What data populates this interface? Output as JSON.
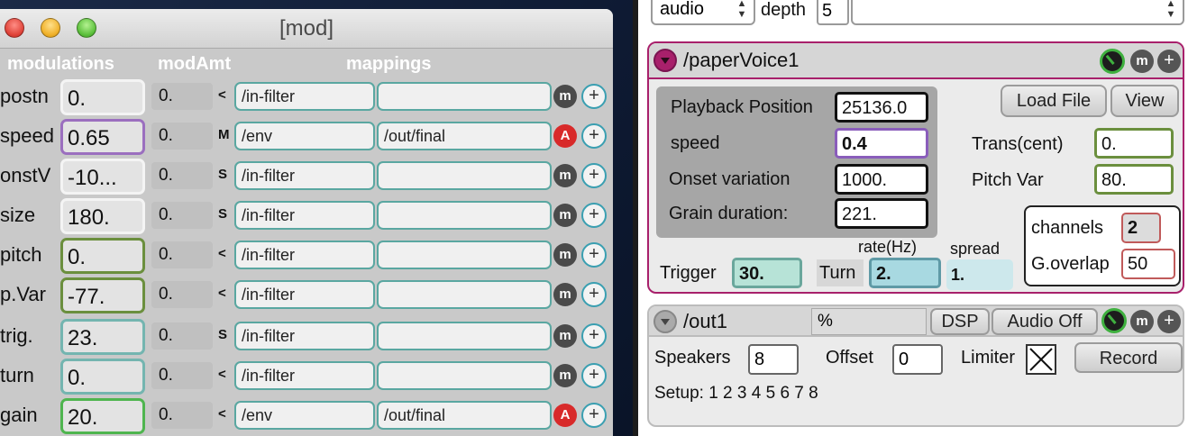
{
  "mod_window": {
    "title": "[mod]",
    "headers": {
      "modulations": "modulations",
      "modAmt": "modAmt",
      "mappings": "mappings"
    },
    "rows": [
      {
        "name": "postn",
        "value": "0.",
        "amt": "0.",
        "sym": "<",
        "src": "/in-filter",
        "dst": "",
        "m": "m",
        "m_active": false,
        "plus": "+",
        "border": "#f4f4f4"
      },
      {
        "name": "speed",
        "value": "0.65",
        "amt": "0.",
        "sym": "M",
        "src": "/env",
        "dst": "/out/final",
        "m": "A",
        "m_active": true,
        "plus": "+",
        "border": "#9b6fbf"
      },
      {
        "name": "onstV",
        "value": "-10...",
        "amt": "0.",
        "sym": "S",
        "src": "/in-filter",
        "dst": "",
        "m": "m",
        "m_active": false,
        "plus": "+",
        "border": "#f4f4f4"
      },
      {
        "name": "size",
        "value": "180.",
        "amt": "0.",
        "sym": "S",
        "src": "/in-filter",
        "dst": "",
        "m": "m",
        "m_active": false,
        "plus": "+",
        "border": "#f4f4f4"
      },
      {
        "name": "pitch",
        "value": "0.",
        "amt": "0.",
        "sym": "<",
        "src": "/in-filter",
        "dst": "",
        "m": "m",
        "m_active": false,
        "plus": "+",
        "border": "#6b8f3e"
      },
      {
        "name": "p.Var",
        "value": "-77.",
        "amt": "0.",
        "sym": "<",
        "src": "/in-filter",
        "dst": "",
        "m": "m",
        "m_active": false,
        "plus": "+",
        "border": "#6b8f3e"
      },
      {
        "name": "trig.",
        "value": "23.",
        "amt": "0.",
        "sym": "S",
        "src": "/in-filter",
        "dst": "",
        "m": "m",
        "m_active": false,
        "plus": "+",
        "border": "#74b5b0"
      },
      {
        "name": "turn",
        "value": "0.",
        "amt": "0.",
        "sym": "<",
        "src": "/in-filter",
        "dst": "",
        "m": "m",
        "m_active": false,
        "plus": "+",
        "border": "#74b5b0"
      },
      {
        "name": "gain",
        "value": "20.",
        "amt": "0.",
        "sym": "<",
        "src": "/env",
        "dst": "/out/final",
        "m": "A",
        "m_active": true,
        "plus": "+",
        "border": "#4fb54f"
      }
    ]
  },
  "top_controls": {
    "audio": "audio",
    "depth_label": "depth",
    "depth_value": "5",
    "big_select": ""
  },
  "paper_voice": {
    "title": "/paperVoice1",
    "m": "m",
    "plus": "+",
    "playback_label": "Playback Position",
    "playback_value": "25136.0",
    "speed_label": "speed",
    "speed_value": "0.4",
    "onset_label": "Onset variation",
    "onset_value": "1000.",
    "grain_label": "Grain duration:",
    "grain_value": "221.",
    "load_file": "Load File",
    "view": "View",
    "trans_label": "Trans(cent)",
    "trans_value": "0.",
    "pitchvar_label": "Pitch Var",
    "pitchvar_value": "80.",
    "rate_label": "rate(Hz)",
    "spread_label": "spread",
    "trigger_label": "Trigger",
    "trigger_value": "30.",
    "turn_label": "Turn",
    "rate_value": "2.",
    "spread_value": "1.",
    "channels_label": "channels",
    "channels_value": "2",
    "goverlap_label": "G.overlap",
    "goverlap_value": "50"
  },
  "out_panel": {
    "title": "/out1",
    "pct": "%",
    "dsp": "DSP",
    "audio_off": "Audio Off",
    "m": "m",
    "plus": "+",
    "speakers_label": "Speakers",
    "speakers_value": "8",
    "offset_label": "Offset",
    "offset_value": "0",
    "limiter_label": "Limiter",
    "record": "Record",
    "setup": "Setup: 1 2 3 4 5 6 7 8"
  }
}
